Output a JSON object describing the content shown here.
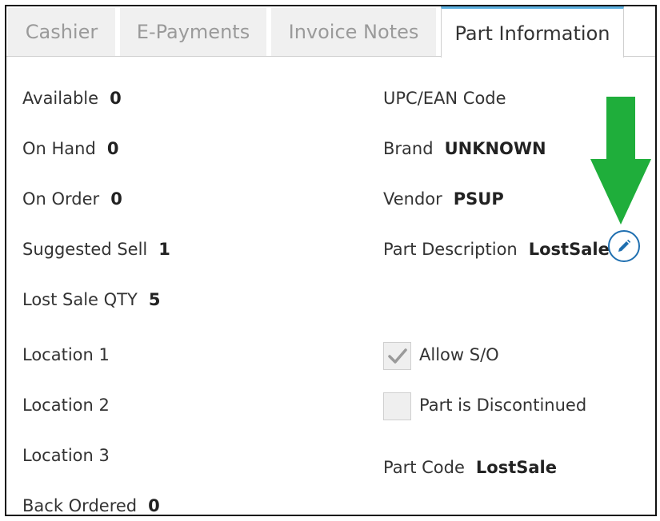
{
  "tabs": [
    {
      "label": "Cashier",
      "active": false
    },
    {
      "label": "E-Payments",
      "active": false
    },
    {
      "label": "Invoice Notes",
      "active": false
    },
    {
      "label": "Part Information",
      "active": true
    }
  ],
  "left_fields": [
    {
      "label": "Available",
      "value": "0"
    },
    {
      "label": "On Hand",
      "value": "0"
    },
    {
      "label": "On Order",
      "value": "0"
    },
    {
      "label": "Suggested Sell",
      "value": "1"
    },
    {
      "label": "Lost Sale QTY",
      "value": "5"
    },
    {
      "label": "Location 1",
      "value": ""
    },
    {
      "label": "Location 2",
      "value": ""
    },
    {
      "label": "Location 3",
      "value": ""
    },
    {
      "label": "Back Ordered",
      "value": "0"
    }
  ],
  "right_fields": {
    "upc": {
      "label": "UPC/EAN Code",
      "value": ""
    },
    "brand": {
      "label": "Brand",
      "value": "UNKNOWN"
    },
    "vendor": {
      "label": "Vendor",
      "value": "PSUP"
    },
    "description": {
      "label": "Part Description",
      "value": "LostSale"
    },
    "part_code": {
      "label": "Part Code",
      "value": "LostSale"
    }
  },
  "checkboxes": {
    "allow_so": {
      "label": "Allow S/O",
      "checked": true
    },
    "discontinued": {
      "label": "Part is Discontinued",
      "checked": false
    }
  },
  "icons": {
    "edit": "pencil-icon",
    "annotation": "down-arrow-icon",
    "check": "checkmark-icon"
  },
  "colors": {
    "active_tab_accent": "#5bb0e0",
    "edit_icon": "#1f6fb0",
    "annotation_arrow": "#1fae3b"
  }
}
